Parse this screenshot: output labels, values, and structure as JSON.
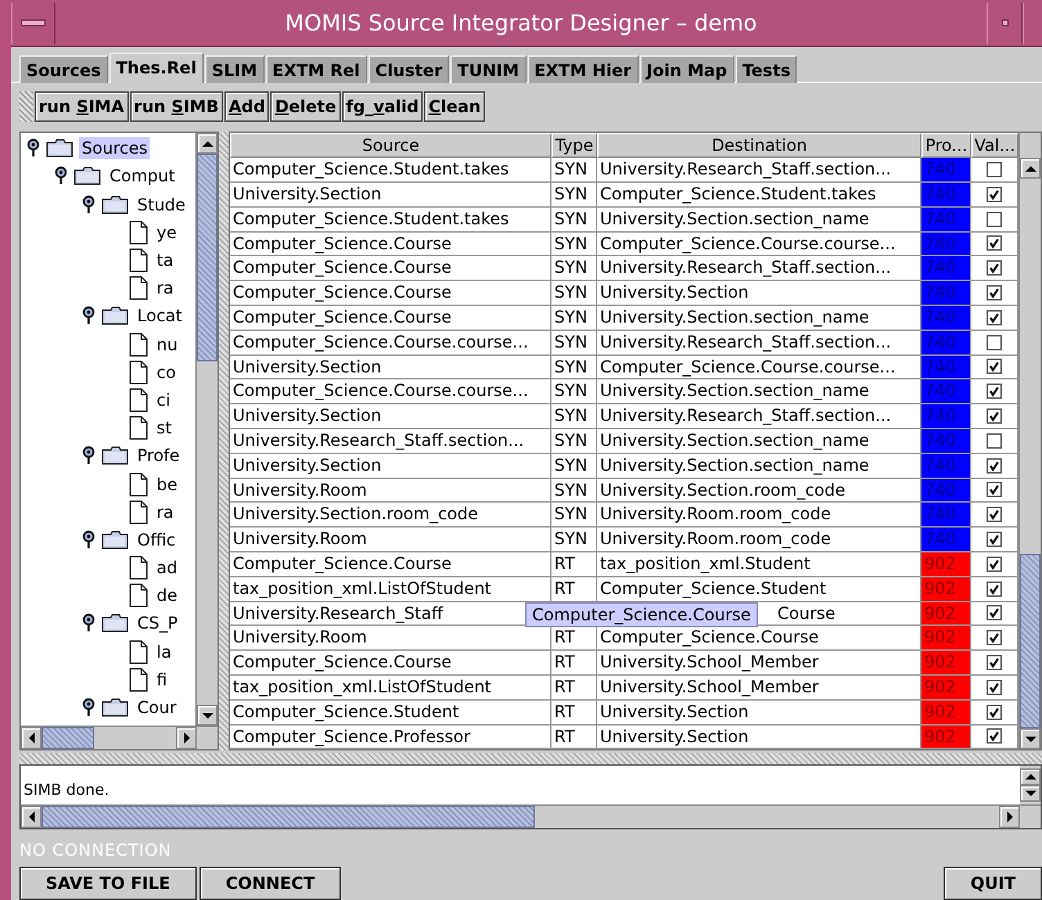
{
  "window": {
    "title": "MOMIS Source Integrator Designer – demo"
  },
  "tabs": [
    {
      "label": "Sources",
      "selected": false
    },
    {
      "label": "Thes.Rel",
      "selected": true
    },
    {
      "label": "SLIM",
      "selected": false
    },
    {
      "label": "EXTM Rel",
      "selected": false
    },
    {
      "label": "Cluster",
      "selected": false
    },
    {
      "label": "TUNIM",
      "selected": false
    },
    {
      "label": "EXTM Hier",
      "selected": false
    },
    {
      "label": "Join Map",
      "selected": false
    },
    {
      "label": "Tests",
      "selected": false
    }
  ],
  "toolbar": [
    {
      "before": "run ",
      "key": "S",
      "after": "IMA"
    },
    {
      "before": "run ",
      "key": "S",
      "after": "IMB"
    },
    {
      "key": "A",
      "after": "dd"
    },
    {
      "key": "D",
      "after": "elete"
    },
    {
      "before": "fg_",
      "key": "v",
      "after": "alid"
    },
    {
      "key": "C",
      "after": "lean"
    }
  ],
  "tree": [
    {
      "label": "Sources",
      "selected": true,
      "expanded": true,
      "children": [
        {
          "label": "Comput",
          "selected": false,
          "expanded": true,
          "children": [
            {
              "label": "Stude",
              "selected": false,
              "expanded": true,
              "children": [
                {
                  "label": "ye",
                  "selected": false
                },
                {
                  "label": "ta",
                  "selected": false
                },
                {
                  "label": "ra",
                  "selected": false
                }
              ]
            },
            {
              "label": "Locat",
              "selected": false,
              "expanded": true,
              "children": [
                {
                  "label": "nu",
                  "selected": false
                },
                {
                  "label": "co",
                  "selected": false
                },
                {
                  "label": "ci",
                  "selected": false
                },
                {
                  "label": "st",
                  "selected": false
                }
              ]
            },
            {
              "label": "Profe",
              "selected": false,
              "expanded": true,
              "children": [
                {
                  "label": "be",
                  "selected": false
                },
                {
                  "label": "ra",
                  "selected": false
                }
              ]
            },
            {
              "label": "Offic",
              "selected": false,
              "expanded": true,
              "children": [
                {
                  "label": "ad",
                  "selected": false
                },
                {
                  "label": "de",
                  "selected": false
                }
              ]
            },
            {
              "label": "CS_P",
              "selected": false,
              "expanded": true,
              "children": [
                {
                  "label": "la",
                  "selected": false
                },
                {
                  "label": "fi",
                  "selected": false
                }
              ]
            },
            {
              "label": "Cour",
              "selected": false,
              "expanded": true
            }
          ]
        }
      ]
    }
  ],
  "table": {
    "columns": [
      "Source",
      "Type",
      "Destination",
      "Pro...",
      "Val..."
    ],
    "rows": [
      {
        "source": "Computer_Science.Student.takes",
        "type": "SYN",
        "destination": "University.Research_Staff.section...",
        "pro": "740",
        "color": "#0000ff",
        "checked": false
      },
      {
        "source": "University.Section",
        "type": "SYN",
        "destination": "Computer_Science.Student.takes",
        "pro": "740",
        "color": "#0000ff",
        "checked": true
      },
      {
        "source": "Computer_Science.Student.takes",
        "type": "SYN",
        "destination": "University.Section.section_name",
        "pro": "740",
        "color": "#0000ff",
        "checked": false
      },
      {
        "source": "Computer_Science.Course",
        "type": "SYN",
        "destination": "Computer_Science.Course.course...",
        "pro": "740",
        "color": "#0000ff",
        "checked": true
      },
      {
        "source": "Computer_Science.Course",
        "type": "SYN",
        "destination": "University.Research_Staff.section...",
        "pro": "740",
        "color": "#0000ff",
        "checked": true
      },
      {
        "source": "Computer_Science.Course",
        "type": "SYN",
        "destination": "University.Section",
        "pro": "740",
        "color": "#0000ff",
        "checked": true
      },
      {
        "source": "Computer_Science.Course",
        "type": "SYN",
        "destination": "University.Section.section_name",
        "pro": "740",
        "color": "#0000ff",
        "checked": true
      },
      {
        "source": "Computer_Science.Course.course...",
        "type": "SYN",
        "destination": "University.Research_Staff.section...",
        "pro": "740",
        "color": "#0000ff",
        "checked": false
      },
      {
        "source": "University.Section",
        "type": "SYN",
        "destination": "Computer_Science.Course.course...",
        "pro": "740",
        "color": "#0000ff",
        "checked": true
      },
      {
        "source": "Computer_Science.Course.course...",
        "type": "SYN",
        "destination": "University.Section.section_name",
        "pro": "740",
        "color": "#0000ff",
        "checked": true
      },
      {
        "source": "University.Section",
        "type": "SYN",
        "destination": "University.Research_Staff.section...",
        "pro": "740",
        "color": "#0000ff",
        "checked": true
      },
      {
        "source": "University.Research_Staff.section...",
        "type": "SYN",
        "destination": "University.Section.section_name",
        "pro": "740",
        "color": "#0000ff",
        "checked": false
      },
      {
        "source": "University.Section",
        "type": "SYN",
        "destination": "University.Section.section_name",
        "pro": "740",
        "color": "#0000ff",
        "checked": true
      },
      {
        "source": "University.Room",
        "type": "SYN",
        "destination": "University.Section.room_code",
        "pro": "740",
        "color": "#0000ff",
        "checked": true
      },
      {
        "source": "University.Section.room_code",
        "type": "SYN",
        "destination": "University.Room.room_code",
        "pro": "740",
        "color": "#0000ff",
        "checked": true
      },
      {
        "source": "University.Room",
        "type": "SYN",
        "destination": "University.Room.room_code",
        "pro": "740",
        "color": "#0000ff",
        "checked": true
      },
      {
        "source": "Computer_Science.Course",
        "type": "RT",
        "destination": "tax_position_xml.Student",
        "pro": "902",
        "color": "#ff0000",
        "checked": true
      },
      {
        "source": "tax_position_xml.ListOfStudent",
        "type": "RT",
        "destination": "Computer_Science.Student",
        "pro": "902",
        "color": "#ff0000",
        "checked": true
      },
      {
        "source": "University.Research_Staff",
        "destination": "Course",
        "tooltip": "Computer_Science.Course",
        "pro": "902",
        "color": "#ff0000",
        "checked": true
      },
      {
        "source": "University.Room",
        "type": "RT",
        "destination": "Computer_Science.Course",
        "pro": "902",
        "color": "#ff0000",
        "checked": true
      },
      {
        "source": "Computer_Science.Course",
        "type": "RT",
        "destination": "University.School_Member",
        "pro": "902",
        "color": "#ff0000",
        "checked": true
      },
      {
        "source": "tax_position_xml.ListOfStudent",
        "type": "RT",
        "destination": "University.School_Member",
        "pro": "902",
        "color": "#ff0000",
        "checked": true
      },
      {
        "source": "Computer_Science.Student",
        "type": "RT",
        "destination": "University.Section",
        "pro": "902",
        "color": "#ff0000",
        "checked": true
      },
      {
        "source": "Computer_Science.Professor",
        "type": "RT",
        "destination": "University.Section",
        "pro": "902",
        "color": "#ff0000",
        "checked": true
      }
    ]
  },
  "log": {
    "text": "SIMB done."
  },
  "status_bar": {
    "text": "NO CONNECTION"
  },
  "buttons": [
    {
      "label": "SAVE TO FILE",
      "kind": "left"
    },
    {
      "label": "CONNECT",
      "kind": "left"
    },
    {
      "label": "QUIT",
      "kind": "right"
    }
  ]
}
